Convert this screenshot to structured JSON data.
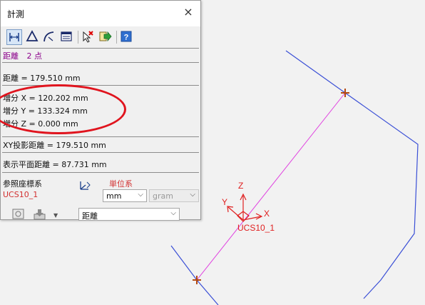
{
  "dialog": {
    "title": "計測",
    "close_glyph": "×",
    "toolbar": {
      "icons": [
        "measure-distance-icon",
        "measure-angle-icon",
        "measure-arc-icon",
        "measure-list-icon",
        "clear-selection-icon",
        "export-icon",
        "help-icon"
      ],
      "help_label": "?"
    },
    "mode_label": "距離",
    "points_label": "2 点",
    "distance_line": "距離 = 179.510 mm",
    "delta_x": "増分 X =    120.202 mm",
    "delta_y": "増分 Y =    133.324 mm",
    "delta_z": "増分 Z =      0.000 mm",
    "xy_projection": "XY投影距離 = 179.510 mm",
    "display_plane": "表示平面距離 = 87.731 mm",
    "reference_label": "参照座標系",
    "ucs_name": "UCS10_1",
    "unit_label": "単位系",
    "unit_length": "mm",
    "unit_mass": "gram",
    "bottom_select": "距離"
  },
  "viewport": {
    "axis_z": "Z",
    "axis_y": "Y",
    "axis_x": "X",
    "ucs_label": "UCS10_1"
  },
  "colors": {
    "highlight_ellipse": "#e0141e",
    "outline": "#3a4fd6",
    "measure_line": "#e040e0",
    "point_marker": "#b44a12",
    "ucs_triad": "#e02020"
  }
}
